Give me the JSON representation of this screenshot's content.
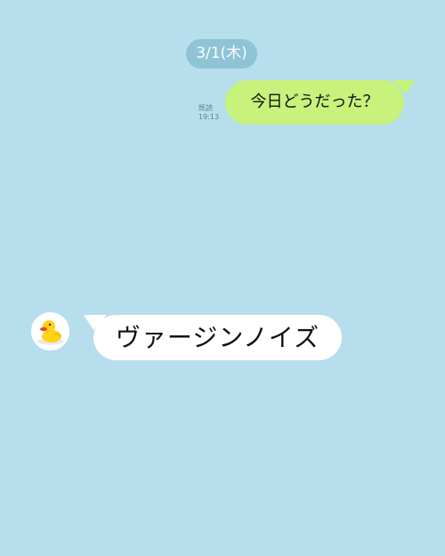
{
  "date_label": "3/1(木)",
  "messages": [
    {
      "side": "sent",
      "text": "今日どうだった？",
      "read_label": "既読",
      "time": "19:13",
      "bubble_color": "#c7f27b"
    },
    {
      "side": "received",
      "text": "ヴァージンノイズ",
      "avatar_icon": "rubber-duck-avatar-icon",
      "bubble_color": "#ffffff"
    }
  ],
  "colors": {
    "background": "#b7deec",
    "date_pill": "#8fc3d6"
  }
}
